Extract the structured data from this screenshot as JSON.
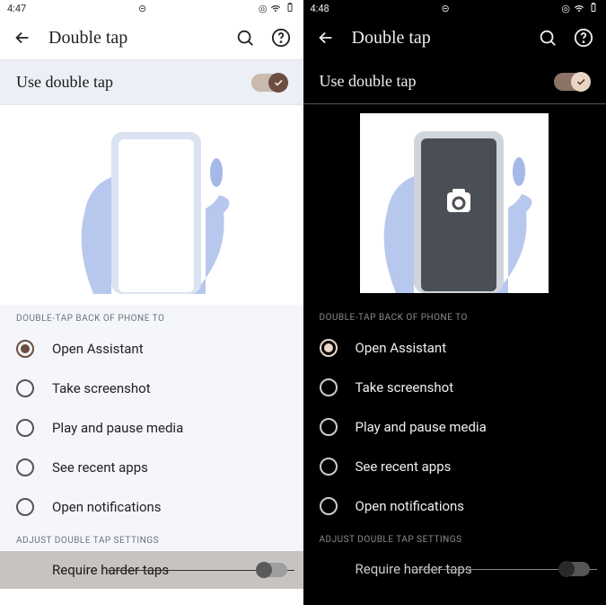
{
  "light": {
    "time": "4:47",
    "page_title": "Double tap",
    "toggle_label": "Use double tap",
    "toggle_on": true,
    "section1": "DOUBLE-TAP BACK OF PHONE TO",
    "options": [
      {
        "label": "Open Assistant",
        "selected": true
      },
      {
        "label": "Take screenshot",
        "selected": false
      },
      {
        "label": "Play and pause media",
        "selected": false
      },
      {
        "label": "See recent apps",
        "selected": false
      },
      {
        "label": "Open notifications",
        "selected": false
      }
    ],
    "section2": "ADJUST DOUBLE TAP SETTINGS",
    "bottom_label": "Require harder taps"
  },
  "dark": {
    "time": "4:48",
    "page_title": "Double tap",
    "toggle_label": "Use double tap",
    "toggle_on": true,
    "section1": "DOUBLE-TAP BACK OF PHONE TO",
    "options": [
      {
        "label": "Open Assistant",
        "selected": true
      },
      {
        "label": "Take screenshot",
        "selected": false
      },
      {
        "label": "Play and pause media",
        "selected": false
      },
      {
        "label": "See recent apps",
        "selected": false
      },
      {
        "label": "Open notifications",
        "selected": false
      }
    ],
    "section2": "ADJUST DOUBLE TAP SETTINGS",
    "bottom_label": "Require harder taps"
  }
}
